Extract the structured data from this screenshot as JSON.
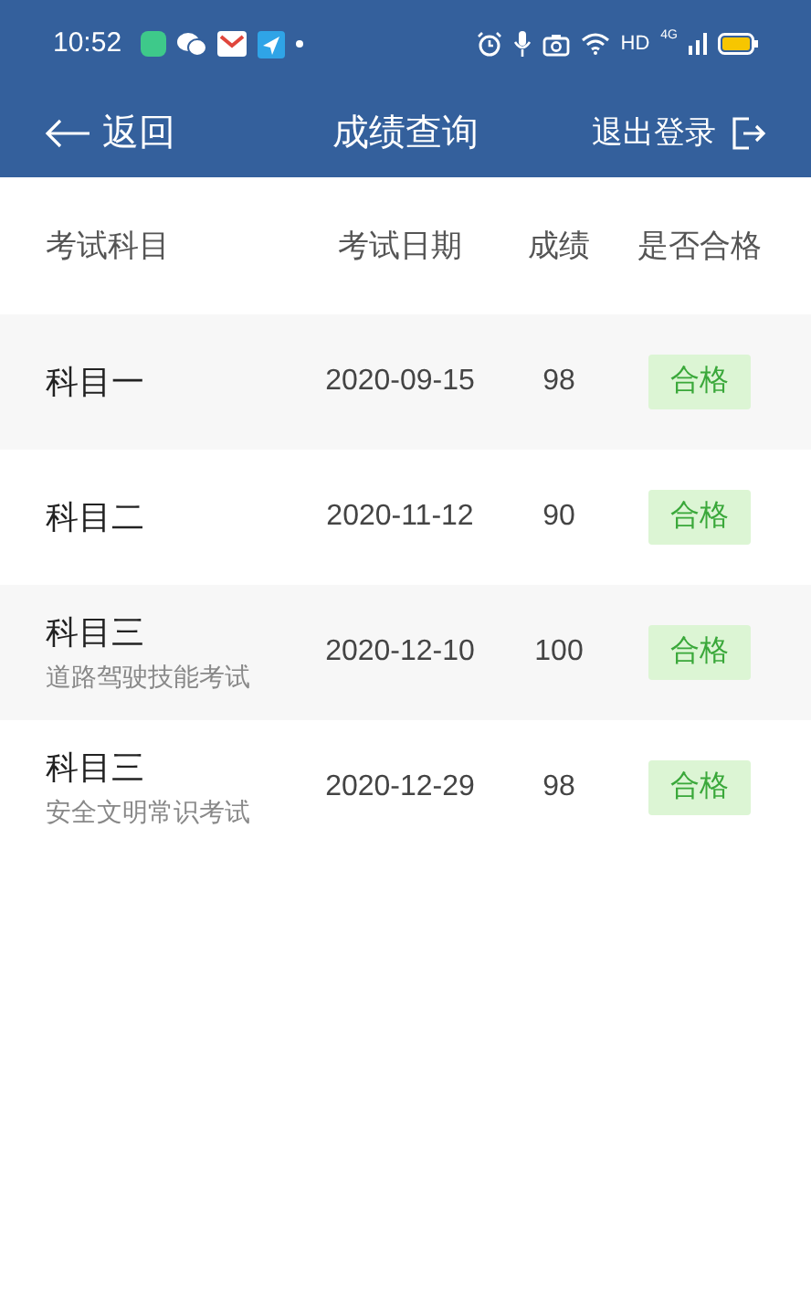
{
  "status_bar": {
    "time": "10:52",
    "network": "HD",
    "signal": "4G"
  },
  "nav": {
    "back": "返回",
    "title": "成绩查询",
    "logout": "退出登录"
  },
  "table": {
    "columns": [
      "考试科目",
      "考试日期",
      "成绩",
      "是否合格"
    ],
    "rows": [
      {
        "subject": "科目一",
        "date": "2020-09-15",
        "score": "98",
        "result": "合格",
        "passed": true
      },
      {
        "subject": "科目二",
        "date": "2020-11-12",
        "score": "90",
        "result": "合格",
        "passed": true
      },
      {
        "subject": "科目三",
        "note": "道路驾驶技能考试",
        "date": "2020-12-10",
        "score": "100",
        "result": "合格",
        "passed": true
      },
      {
        "subject": "科目三",
        "note": "安全文明常识考试",
        "date": "2020-12-29",
        "score": "98",
        "result": "合格",
        "passed": true
      }
    ]
  }
}
